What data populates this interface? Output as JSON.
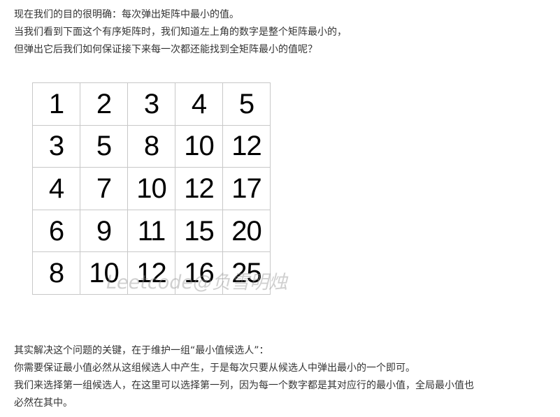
{
  "intro": {
    "lines": [
      "现在我们的目的很明确：每次弹出矩阵中最小的值。",
      "当我们看到下面这个有序矩阵时，我们知道左上角的数字是整个矩阵最小的，",
      "但弹出它后我们如何保证接下来每一次都还能找到全矩阵最小的值呢？"
    ]
  },
  "matrix": {
    "rows": [
      [
        "1",
        "2",
        "3",
        "4",
        "5"
      ],
      [
        "3",
        "5",
        "8",
        "10",
        "12"
      ],
      [
        "4",
        "7",
        "10",
        "12",
        "17"
      ],
      [
        "6",
        "9",
        "11",
        "15",
        "20"
      ],
      [
        "8",
        "10",
        "12",
        "16",
        "25"
      ]
    ]
  },
  "watermark": "Leetcode@负雪明烛",
  "explain": {
    "lines": [
      "其实解决这个问题的关键，在于维护一组“最小值候选人”：",
      "你需要保证最小值必然从这组候选人中产生，于是每次只要从候选人中弹出最小的一个即可。",
      "我们来选择第一组候选人，在这里可以选择第一列，因为每一个数字都是其对应行的最小值，全局最小值也",
      "必然在其中。"
    ]
  }
}
